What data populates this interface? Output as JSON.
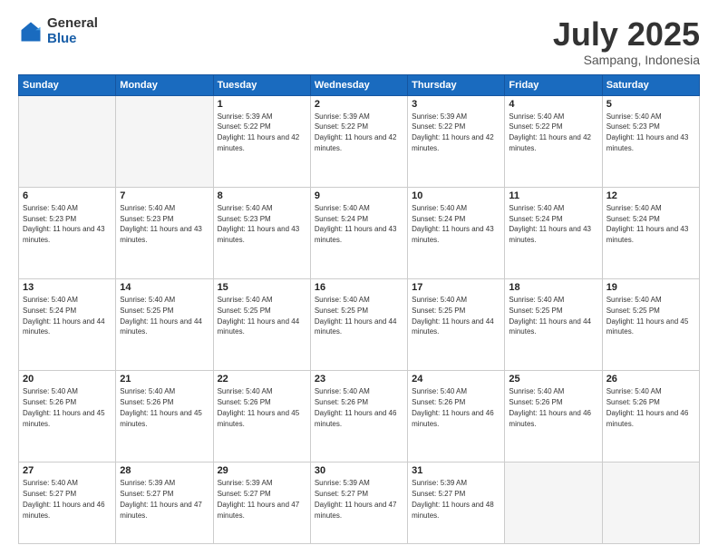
{
  "logo": {
    "general": "General",
    "blue": "Blue"
  },
  "header": {
    "month": "July 2025",
    "location": "Sampang, Indonesia"
  },
  "weekdays": [
    "Sunday",
    "Monday",
    "Tuesday",
    "Wednesday",
    "Thursday",
    "Friday",
    "Saturday"
  ],
  "weeks": [
    [
      {
        "day": "",
        "empty": true
      },
      {
        "day": "",
        "empty": true
      },
      {
        "day": "1",
        "sunrise": "5:39 AM",
        "sunset": "5:22 PM",
        "daylight": "11 hours and 42 minutes."
      },
      {
        "day": "2",
        "sunrise": "5:39 AM",
        "sunset": "5:22 PM",
        "daylight": "11 hours and 42 minutes."
      },
      {
        "day": "3",
        "sunrise": "5:39 AM",
        "sunset": "5:22 PM",
        "daylight": "11 hours and 42 minutes."
      },
      {
        "day": "4",
        "sunrise": "5:40 AM",
        "sunset": "5:22 PM",
        "daylight": "11 hours and 42 minutes."
      },
      {
        "day": "5",
        "sunrise": "5:40 AM",
        "sunset": "5:23 PM",
        "daylight": "11 hours and 43 minutes."
      }
    ],
    [
      {
        "day": "6",
        "sunrise": "5:40 AM",
        "sunset": "5:23 PM",
        "daylight": "11 hours and 43 minutes."
      },
      {
        "day": "7",
        "sunrise": "5:40 AM",
        "sunset": "5:23 PM",
        "daylight": "11 hours and 43 minutes."
      },
      {
        "day": "8",
        "sunrise": "5:40 AM",
        "sunset": "5:23 PM",
        "daylight": "11 hours and 43 minutes."
      },
      {
        "day": "9",
        "sunrise": "5:40 AM",
        "sunset": "5:24 PM",
        "daylight": "11 hours and 43 minutes."
      },
      {
        "day": "10",
        "sunrise": "5:40 AM",
        "sunset": "5:24 PM",
        "daylight": "11 hours and 43 minutes."
      },
      {
        "day": "11",
        "sunrise": "5:40 AM",
        "sunset": "5:24 PM",
        "daylight": "11 hours and 43 minutes."
      },
      {
        "day": "12",
        "sunrise": "5:40 AM",
        "sunset": "5:24 PM",
        "daylight": "11 hours and 43 minutes."
      }
    ],
    [
      {
        "day": "13",
        "sunrise": "5:40 AM",
        "sunset": "5:24 PM",
        "daylight": "11 hours and 44 minutes."
      },
      {
        "day": "14",
        "sunrise": "5:40 AM",
        "sunset": "5:25 PM",
        "daylight": "11 hours and 44 minutes."
      },
      {
        "day": "15",
        "sunrise": "5:40 AM",
        "sunset": "5:25 PM",
        "daylight": "11 hours and 44 minutes."
      },
      {
        "day": "16",
        "sunrise": "5:40 AM",
        "sunset": "5:25 PM",
        "daylight": "11 hours and 44 minutes."
      },
      {
        "day": "17",
        "sunrise": "5:40 AM",
        "sunset": "5:25 PM",
        "daylight": "11 hours and 44 minutes."
      },
      {
        "day": "18",
        "sunrise": "5:40 AM",
        "sunset": "5:25 PM",
        "daylight": "11 hours and 44 minutes."
      },
      {
        "day": "19",
        "sunrise": "5:40 AM",
        "sunset": "5:25 PM",
        "daylight": "11 hours and 45 minutes."
      }
    ],
    [
      {
        "day": "20",
        "sunrise": "5:40 AM",
        "sunset": "5:26 PM",
        "daylight": "11 hours and 45 minutes."
      },
      {
        "day": "21",
        "sunrise": "5:40 AM",
        "sunset": "5:26 PM",
        "daylight": "11 hours and 45 minutes."
      },
      {
        "day": "22",
        "sunrise": "5:40 AM",
        "sunset": "5:26 PM",
        "daylight": "11 hours and 45 minutes."
      },
      {
        "day": "23",
        "sunrise": "5:40 AM",
        "sunset": "5:26 PM",
        "daylight": "11 hours and 46 minutes."
      },
      {
        "day": "24",
        "sunrise": "5:40 AM",
        "sunset": "5:26 PM",
        "daylight": "11 hours and 46 minutes."
      },
      {
        "day": "25",
        "sunrise": "5:40 AM",
        "sunset": "5:26 PM",
        "daylight": "11 hours and 46 minutes."
      },
      {
        "day": "26",
        "sunrise": "5:40 AM",
        "sunset": "5:26 PM",
        "daylight": "11 hours and 46 minutes."
      }
    ],
    [
      {
        "day": "27",
        "sunrise": "5:40 AM",
        "sunset": "5:27 PM",
        "daylight": "11 hours and 46 minutes."
      },
      {
        "day": "28",
        "sunrise": "5:39 AM",
        "sunset": "5:27 PM",
        "daylight": "11 hours and 47 minutes."
      },
      {
        "day": "29",
        "sunrise": "5:39 AM",
        "sunset": "5:27 PM",
        "daylight": "11 hours and 47 minutes."
      },
      {
        "day": "30",
        "sunrise": "5:39 AM",
        "sunset": "5:27 PM",
        "daylight": "11 hours and 47 minutes."
      },
      {
        "day": "31",
        "sunrise": "5:39 AM",
        "sunset": "5:27 PM",
        "daylight": "11 hours and 48 minutes."
      },
      {
        "day": "",
        "empty": true
      },
      {
        "day": "",
        "empty": true
      }
    ]
  ]
}
